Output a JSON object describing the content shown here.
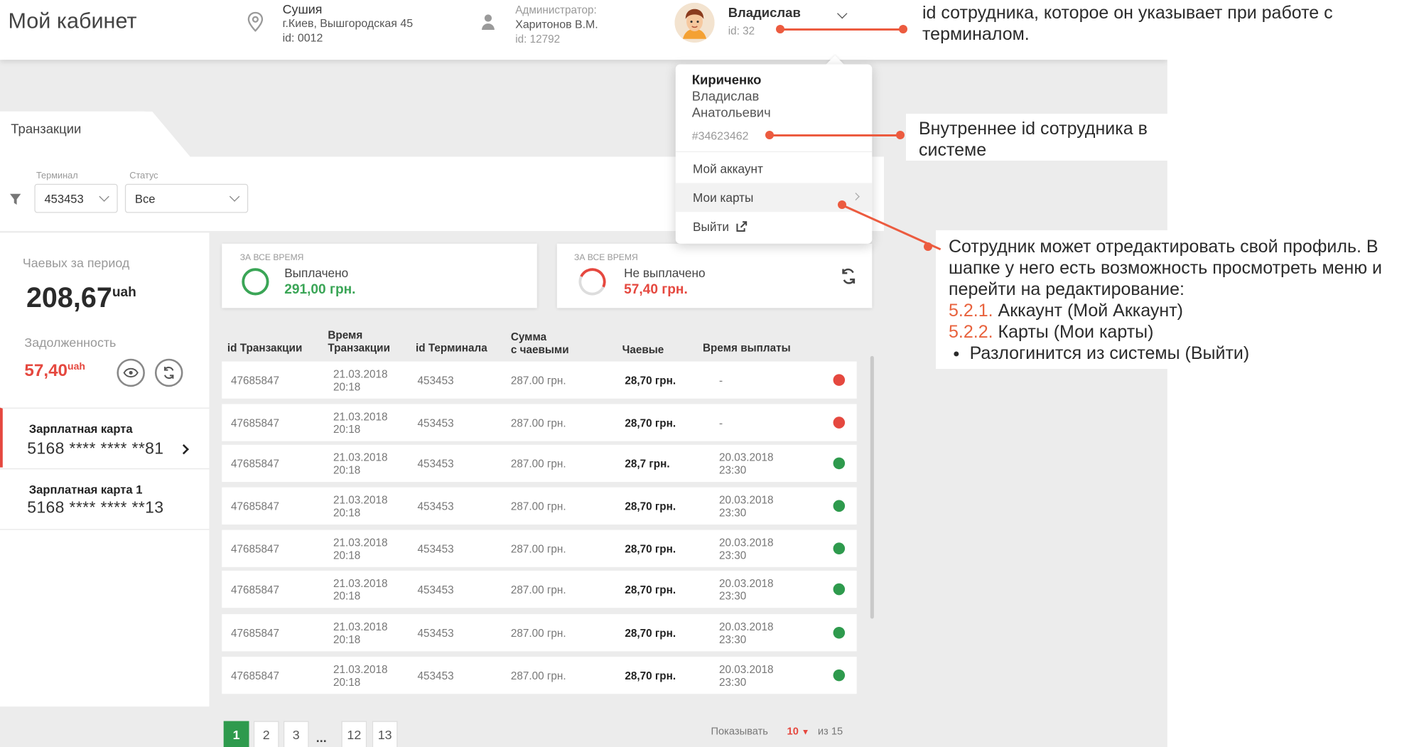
{
  "header": {
    "title": "Мой кабинет",
    "store": {
      "name": "Сушия",
      "address": "г.Киев, Вышгородская 45",
      "id": "id: 0012"
    },
    "admin": {
      "role": "Администратор:",
      "name": "Харитонов В.М.",
      "id": "id: 12792"
    },
    "user": {
      "name": "Владислав",
      "id": "id: 32"
    }
  },
  "dropdown": {
    "surname": "Кириченко",
    "first": "Владислав",
    "patronymic": "Анатольевич",
    "internal_id": "#34623462",
    "items": [
      {
        "label": "Мой аккаунт"
      },
      {
        "label": "Мои карты"
      },
      {
        "label": "Выйти"
      }
    ]
  },
  "tab": {
    "label": "Транзакции"
  },
  "filters": {
    "terminal": {
      "label": "Терминал",
      "value": "453453"
    },
    "status": {
      "label": "Статус",
      "value": "Все"
    }
  },
  "left": {
    "tips_label": "Чаевых за период",
    "tips_value": "208,67",
    "tips_unit": "uah",
    "debt_label": "Задолженность",
    "debt_value": "57,40",
    "debt_unit": "uah",
    "cards": [
      {
        "title": "Зарплатная карта",
        "number": "5168 **** **** **81"
      },
      {
        "title": "Зарплатная карта 1",
        "number": "5168 **** **** **13"
      }
    ]
  },
  "stats": [
    {
      "caption": "ЗА ВСЕ ВРЕМЯ",
      "label": "Выплачено",
      "value": "291,00 грн."
    },
    {
      "caption": "ЗА ВСЕ ВРЕМЯ",
      "label": "Не выплачено",
      "value": "57,40 грн."
    }
  ],
  "table": {
    "headers": {
      "id": "id Транзакции",
      "time1": "Время",
      "time2": "Транзакции",
      "term": "id Терминала",
      "sum1": "Сумма",
      "sum2": "с чаевыми",
      "tips": "Чаевые",
      "paid": "Время выплаты"
    },
    "rows": [
      {
        "id": "47685847",
        "date": "21.03.2018",
        "time": "20:18",
        "terminal": "453453",
        "sum": "287.00 грн.",
        "tip": "28,70 грн.",
        "paid_date": "-",
        "paid_time": "",
        "status": "unpaid"
      },
      {
        "id": "47685847",
        "date": "21.03.2018",
        "time": "20:18",
        "terminal": "453453",
        "sum": "287.00 грн.",
        "tip": "28,70 грн.",
        "paid_date": "-",
        "paid_time": "",
        "status": "unpaid"
      },
      {
        "id": "47685847",
        "date": "21.03.2018",
        "time": "20:18",
        "terminal": "453453",
        "sum": "287.00 грн.",
        "tip": "28,7 грн.",
        "paid_date": "20.03.2018",
        "paid_time": "23:30",
        "status": "paid"
      },
      {
        "id": "47685847",
        "date": "21.03.2018",
        "time": "20:18",
        "terminal": "453453",
        "sum": "287.00 грн.",
        "tip": "28,70 грн.",
        "paid_date": "20.03.2018",
        "paid_time": "23:30",
        "status": "paid"
      },
      {
        "id": "47685847",
        "date": "21.03.2018",
        "time": "20:18",
        "terminal": "453453",
        "sum": "287.00 грн.",
        "tip": "28,70 грн.",
        "paid_date": "20.03.2018",
        "paid_time": "23:30",
        "status": "paid"
      },
      {
        "id": "47685847",
        "date": "21.03.2018",
        "time": "20:18",
        "terminal": "453453",
        "sum": "287.00 грн.",
        "tip": "28,70 грн.",
        "paid_date": "20.03.2018",
        "paid_time": "23:30",
        "status": "paid"
      },
      {
        "id": "47685847",
        "date": "21.03.2018",
        "time": "20:18",
        "terminal": "453453",
        "sum": "287.00 грн.",
        "tip": "28,70 грн.",
        "paid_date": "20.03.2018",
        "paid_time": "23:30",
        "status": "paid"
      },
      {
        "id": "47685847",
        "date": "21.03.2018",
        "time": "20:18",
        "terminal": "453453",
        "sum": "287.00 грн.",
        "tip": "28,70 грн.",
        "paid_date": "20.03.2018",
        "paid_time": "23:30",
        "status": "paid"
      }
    ]
  },
  "pagination": {
    "pages": [
      "1",
      "2",
      "3",
      "...",
      "12",
      "13"
    ],
    "show_label": "Показывать",
    "per_page": "10",
    "of_label": "из 15"
  },
  "annotations": {
    "a1": "id сотрудника, которое он указывает при работе с терминалом.",
    "a2": "Внутреннее id сотрудника в системе",
    "a3_intro": "Сотрудник может отредактировать свой профиль. В шапке у него есть возможность просмотреть меню и перейти на редактирование:",
    "a3_n1": "5.2.1.",
    "a3_t1": "Аккаунт (Мой Аккаунт)",
    "a3_n2": "5.2.2.",
    "a3_t2": "Карты (Мои карты)",
    "a3_t3": "Разлогинится из системы (Выйти)"
  },
  "colors": {
    "red": "#e5483f",
    "green": "#2e9a4d",
    "annotation": "#ec5b3f"
  }
}
